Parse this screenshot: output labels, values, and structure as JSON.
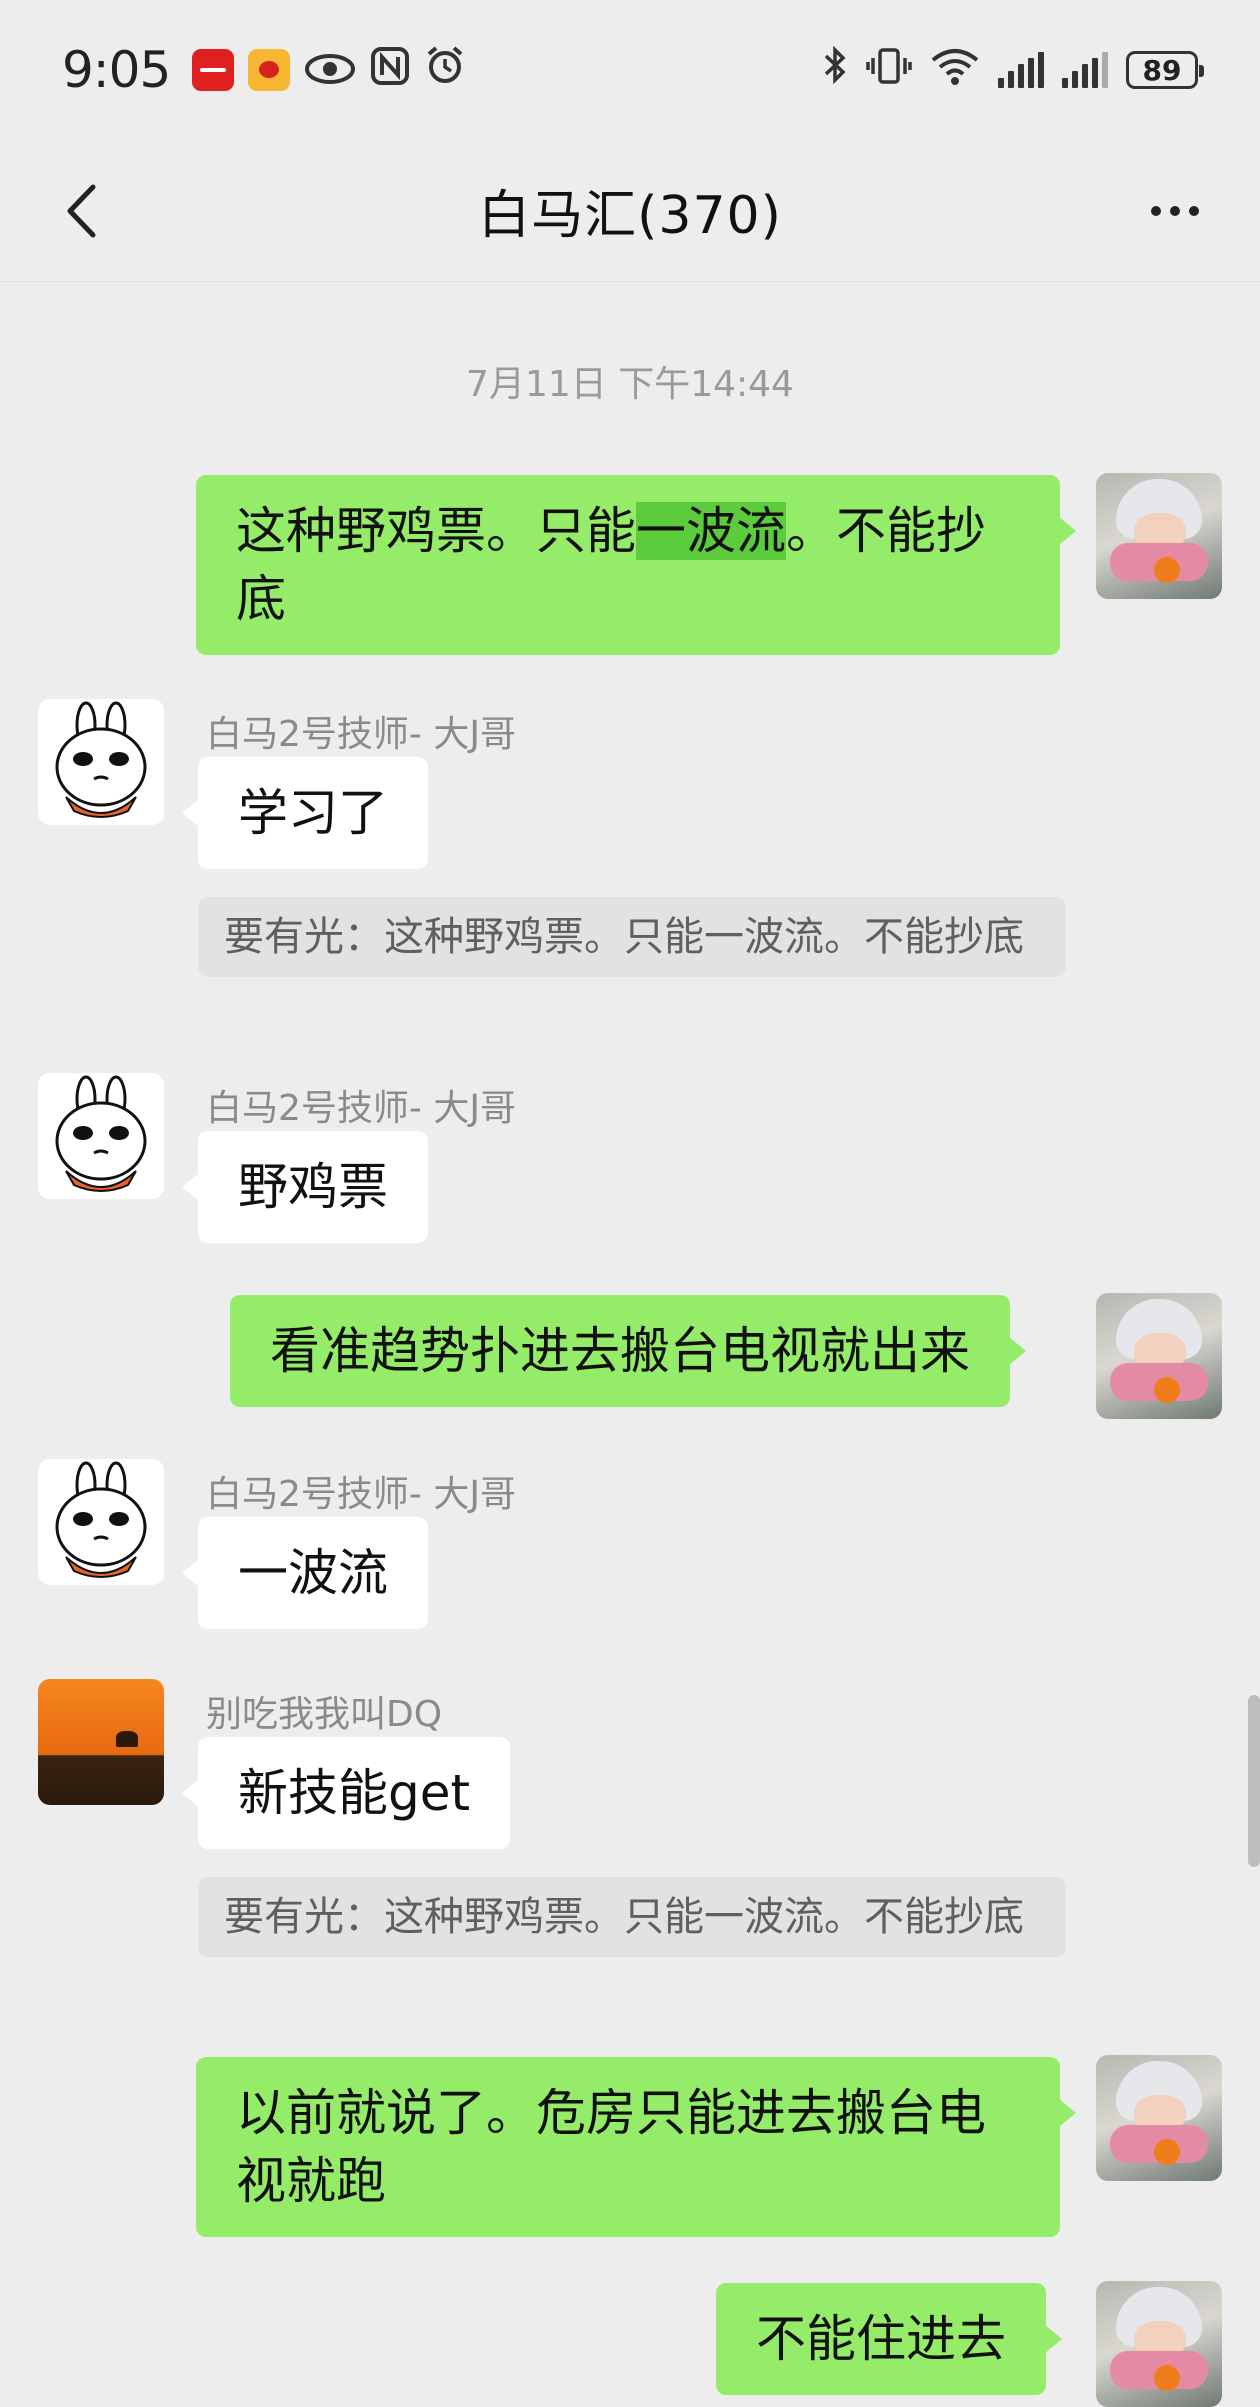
{
  "status_bar": {
    "time": "9:05",
    "battery": "89"
  },
  "header": {
    "title": "白马汇(370)"
  },
  "chat": {
    "timestamp": "7月11日 下午14:44",
    "messages": [
      {
        "side": "right",
        "text_before": "这种野鸡票。只能",
        "text_highlight": "一波流",
        "text_after": "。不能抄底"
      },
      {
        "side": "left",
        "sender": "白马2号技师- 大J哥",
        "text": "学习了",
        "quote": "要有光：这种野鸡票。只能一波流。不能抄底"
      },
      {
        "side": "left",
        "sender": "白马2号技师- 大J哥",
        "text": "野鸡票"
      },
      {
        "side": "right",
        "text": "看准趋势扑进去搬台电视就出来"
      },
      {
        "side": "left",
        "sender": "白马2号技师- 大J哥",
        "text": "一波流"
      },
      {
        "side": "left",
        "sender": "别吃我我叫DQ",
        "text": "新技能get",
        "quote": "要有光：这种野鸡票。只能一波流。不能抄底"
      },
      {
        "side": "right",
        "text": "以前就说了。危房只能进去搬台电视就跑"
      },
      {
        "side": "right",
        "text": "不能住进去"
      }
    ]
  },
  "colors": {
    "background": "#ededed",
    "bubble_self": "#95ec69",
    "bubble_other": "#ffffff",
    "highlight": "#5ccb3c"
  }
}
